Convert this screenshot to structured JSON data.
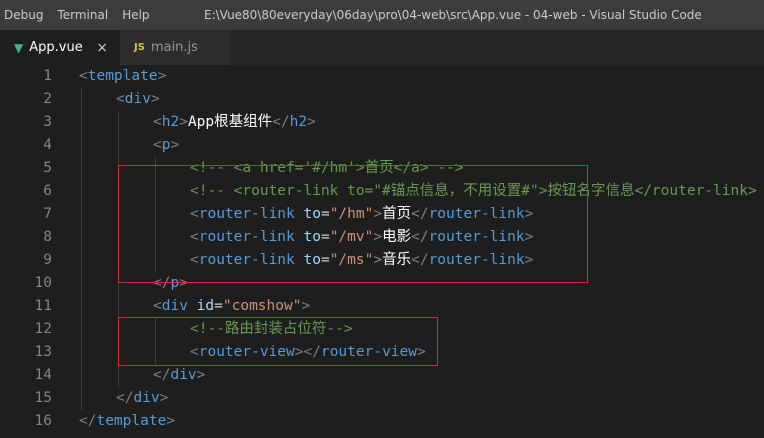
{
  "menu": [
    "Debug",
    "Terminal",
    "Help"
  ],
  "window_title": "E:\\Vue80\\80everyday\\06day\\pro\\04-web\\src\\App.vue - 04-web - Visual Studio Code",
  "tabs": [
    {
      "label": "App.vue",
      "icon": "vue-icon",
      "active": true,
      "close": "×"
    },
    {
      "label": "main.js",
      "icon": "js-icon",
      "icon_text": "JS",
      "active": false
    }
  ],
  "lines": [
    {
      "n": "1",
      "indent": 0,
      "tokens": [
        [
          "br",
          "<"
        ],
        [
          "tag",
          "template"
        ],
        [
          "br",
          ">"
        ]
      ]
    },
    {
      "n": "2",
      "indent": 1,
      "tokens": [
        [
          "br",
          "<"
        ],
        [
          "tag",
          "div"
        ],
        [
          "br",
          ">"
        ]
      ]
    },
    {
      "n": "3",
      "indent": 2,
      "tokens": [
        [
          "br",
          "<"
        ],
        [
          "tag",
          "h2"
        ],
        [
          "br",
          ">"
        ],
        [
          "text",
          "App根基组件"
        ],
        [
          "br",
          "</"
        ],
        [
          "tag",
          "h2"
        ],
        [
          "br",
          ">"
        ]
      ]
    },
    {
      "n": "4",
      "indent": 2,
      "tokens": [
        [
          "br",
          "<"
        ],
        [
          "tag",
          "p"
        ],
        [
          "br",
          ">"
        ]
      ]
    },
    {
      "n": "5",
      "indent": 3,
      "tokens": [
        [
          "com",
          "<!-- <a href='#/hm'>首页</a> -->"
        ]
      ]
    },
    {
      "n": "6",
      "indent": 3,
      "tokens": [
        [
          "com",
          "<!-- <router-link to=\"#锚点信息，不用设置#\">按钮名字信息</router-link> -->"
        ]
      ]
    },
    {
      "n": "7",
      "indent": 3,
      "tokens": [
        [
          "br",
          "<"
        ],
        [
          "tag",
          "router-link"
        ],
        [
          "eq",
          " "
        ],
        [
          "attr",
          "to"
        ],
        [
          "eq",
          "="
        ],
        [
          "str",
          "\"/hm\""
        ],
        [
          "br",
          ">"
        ],
        [
          "text",
          "首页"
        ],
        [
          "br",
          "</"
        ],
        [
          "tag",
          "router-link"
        ],
        [
          "br",
          ">"
        ]
      ]
    },
    {
      "n": "8",
      "indent": 3,
      "tokens": [
        [
          "br",
          "<"
        ],
        [
          "tag",
          "router-link"
        ],
        [
          "eq",
          " "
        ],
        [
          "attr",
          "to"
        ],
        [
          "eq",
          "="
        ],
        [
          "str",
          "\"/mv\""
        ],
        [
          "br",
          ">"
        ],
        [
          "text",
          "电影"
        ],
        [
          "br",
          "</"
        ],
        [
          "tag",
          "router-link"
        ],
        [
          "br",
          ">"
        ]
      ]
    },
    {
      "n": "9",
      "indent": 3,
      "tokens": [
        [
          "br",
          "<"
        ],
        [
          "tag",
          "router-link"
        ],
        [
          "eq",
          " "
        ],
        [
          "attr",
          "to"
        ],
        [
          "eq",
          "="
        ],
        [
          "str",
          "\"/ms\""
        ],
        [
          "br",
          ">"
        ],
        [
          "text",
          "音乐"
        ],
        [
          "br",
          "</"
        ],
        [
          "tag",
          "router-link"
        ],
        [
          "br",
          ">"
        ]
      ]
    },
    {
      "n": "10",
      "indent": 2,
      "tokens": [
        [
          "br",
          "</"
        ],
        [
          "tag",
          "p"
        ],
        [
          "br",
          ">"
        ]
      ]
    },
    {
      "n": "11",
      "indent": 2,
      "tokens": [
        [
          "br",
          "<"
        ],
        [
          "tag",
          "div"
        ],
        [
          "eq",
          " "
        ],
        [
          "attr",
          "id"
        ],
        [
          "eq",
          "="
        ],
        [
          "str",
          "\"comshow\""
        ],
        [
          "br",
          ">"
        ]
      ]
    },
    {
      "n": "12",
      "indent": 3,
      "tokens": [
        [
          "com",
          "<!--路由封装占位符-->"
        ]
      ]
    },
    {
      "n": "13",
      "indent": 3,
      "tokens": [
        [
          "br",
          "<"
        ],
        [
          "tag",
          "router-view"
        ],
        [
          "br",
          "></"
        ],
        [
          "tag",
          "router-view"
        ],
        [
          "br",
          ">"
        ]
      ]
    },
    {
      "n": "14",
      "indent": 2,
      "tokens": [
        [
          "br",
          "</"
        ],
        [
          "tag",
          "div"
        ],
        [
          "br",
          ">"
        ]
      ]
    },
    {
      "n": "15",
      "indent": 1,
      "tokens": [
        [
          "br",
          "</"
        ],
        [
          "tag",
          "div"
        ],
        [
          "br",
          ">"
        ]
      ]
    },
    {
      "n": "16",
      "indent": 0,
      "tokens": [
        [
          "br",
          "</"
        ],
        [
          "tag",
          "template"
        ],
        [
          "br",
          ">"
        ]
      ]
    }
  ]
}
